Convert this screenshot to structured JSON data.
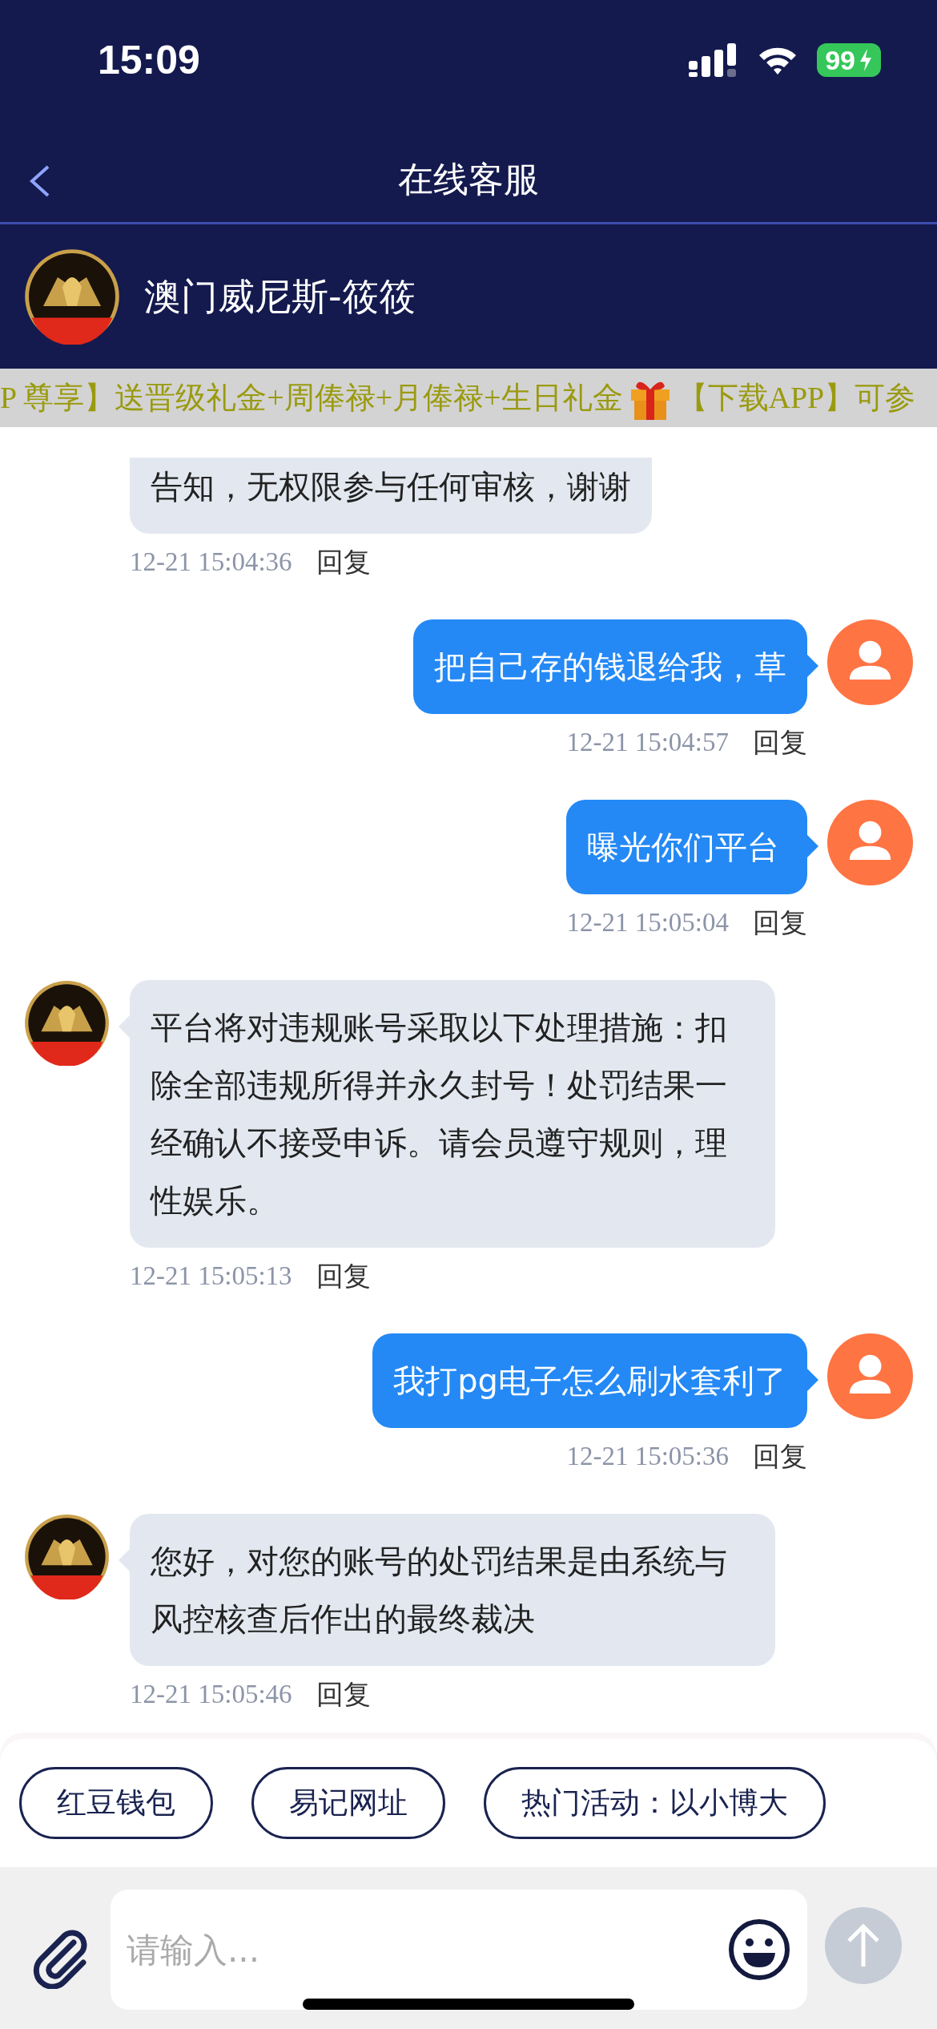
{
  "status_bar": {
    "time": "15:09",
    "battery": "99"
  },
  "nav": {
    "title": "在线客服"
  },
  "agent": {
    "name": "澳门威尼斯-筱筱"
  },
  "marquee": {
    "parts": [
      {
        "kind": "text",
        "text": "P 尊享】送晋级礼金+周俸禄+月俸禄+生日礼金"
      },
      {
        "kind": "gift"
      },
      {
        "kind": "text",
        "text": "【下载APP】可参"
      }
    ]
  },
  "messages": [
    {
      "kind": "agent",
      "cut_off_top": true,
      "text": "告知，无权限参与任何审核，谢谢",
      "time": "12-21 15:04:36",
      "reply": "回复"
    },
    {
      "kind": "user",
      "cut_off_top": false,
      "text": "把自己存的钱退给我，草",
      "time": "12-21 15:04:57",
      "reply": "回复"
    },
    {
      "kind": "user",
      "cut_off_top": false,
      "text": "曝光你们平台",
      "time": "12-21 15:05:04",
      "reply": "回复"
    },
    {
      "kind": "agent",
      "cut_off_top": false,
      "text": "平台将对违规账号采取以下处理措施：扣除全部违规所得并永久封号！处罚结果一经确认不接受申诉。请会员遵守规则，理性娱乐。",
      "time": "12-21 15:05:13",
      "reply": "回复"
    },
    {
      "kind": "user",
      "cut_off_top": false,
      "text": "我打pg电子怎么刷水套利了",
      "time": "12-21 15:05:36",
      "reply": "回复"
    },
    {
      "kind": "agent",
      "cut_off_top": false,
      "text": "您好，对您的账号的处罚结果是由系统与风控核查后作出的最终裁决",
      "time": "12-21 15:05:46",
      "reply": "回复"
    }
  ],
  "quick_replies": [
    "红豆钱包",
    "易记网址",
    "热门活动：以小博大"
  ],
  "composer": {
    "placeholder": "请输入...",
    "send_disabled": true
  }
}
